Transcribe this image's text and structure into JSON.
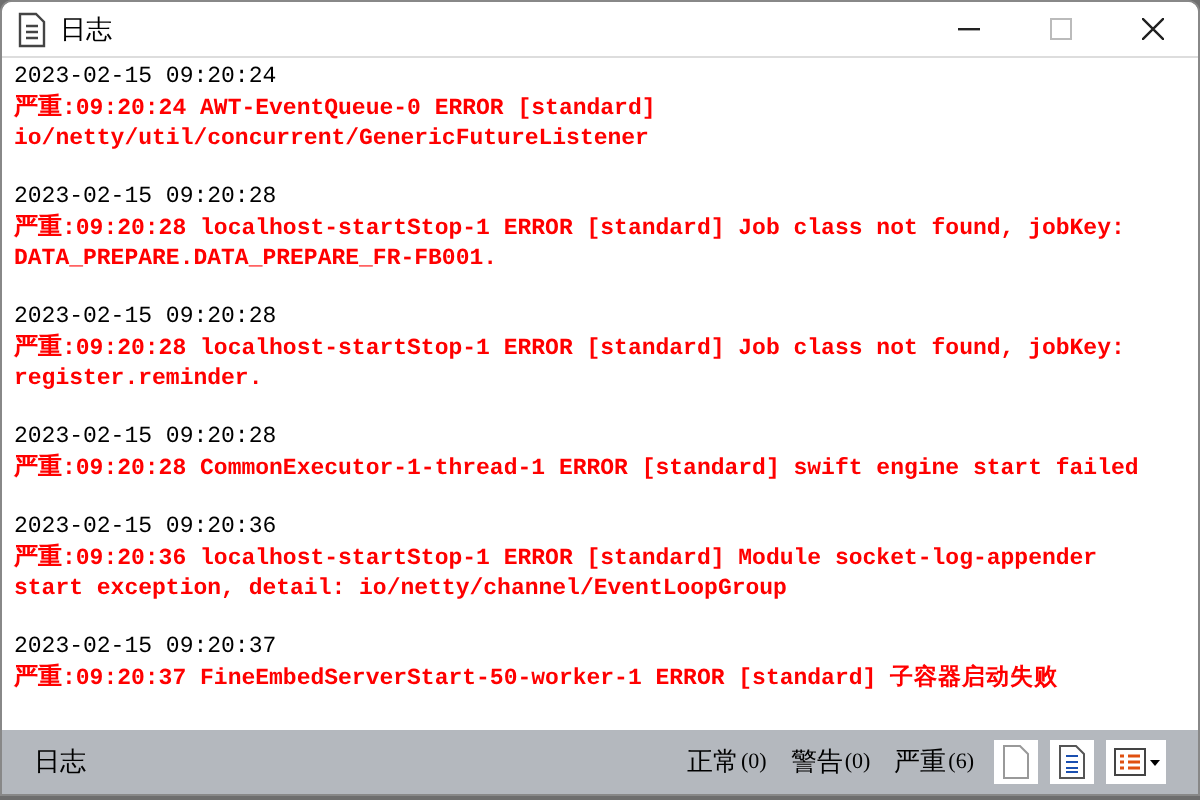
{
  "window": {
    "title": "日志"
  },
  "entries": [
    {
      "time": "2023-02-15 09:20:24",
      "kind": "error",
      "level_label": "严重",
      "lines": [
        ":09:20:24 AWT-EventQueue-0 ERROR [standard]",
        "io/netty/util/concurrent/GenericFutureListener"
      ]
    },
    {
      "time": "2023-02-15 09:20:28",
      "kind": "error",
      "level_label": "严重",
      "lines": [
        ":09:20:28 localhost-startStop-1 ERROR [standard] Job class not found, jobKey:",
        "DATA_PREPARE.DATA_PREPARE_FR-FB001."
      ]
    },
    {
      "time": "2023-02-15 09:20:28",
      "kind": "error",
      "level_label": "严重",
      "lines": [
        ":09:20:28 localhost-startStop-1 ERROR [standard] Job class not found, jobKey:",
        "register.reminder."
      ]
    },
    {
      "time": "2023-02-15 09:20:28",
      "kind": "error",
      "level_label": "严重",
      "lines": [
        ":09:20:28 CommonExecutor-1-thread-1 ERROR [standard] swift engine start failed"
      ]
    },
    {
      "time": "2023-02-15 09:20:36",
      "kind": "error",
      "level_label": "严重",
      "lines": [
        ":09:20:36 localhost-startStop-1 ERROR [standard] Module socket-log-appender",
        "start exception, detail: io/netty/channel/EventLoopGroup"
      ]
    },
    {
      "time": "2023-02-15 09:20:37",
      "kind": "error",
      "level_label": "严重",
      "lines": [
        ":09:20:37 FineEmbedServerStart-50-worker-1 ERROR [standard] 子容器启动失败"
      ]
    }
  ],
  "status_bar": {
    "label": "日志",
    "counts": [
      {
        "label": "正常",
        "count": "(0)"
      },
      {
        "label": "警告",
        "count": "(0)"
      },
      {
        "label": "严重",
        "count": "(6)"
      }
    ]
  }
}
